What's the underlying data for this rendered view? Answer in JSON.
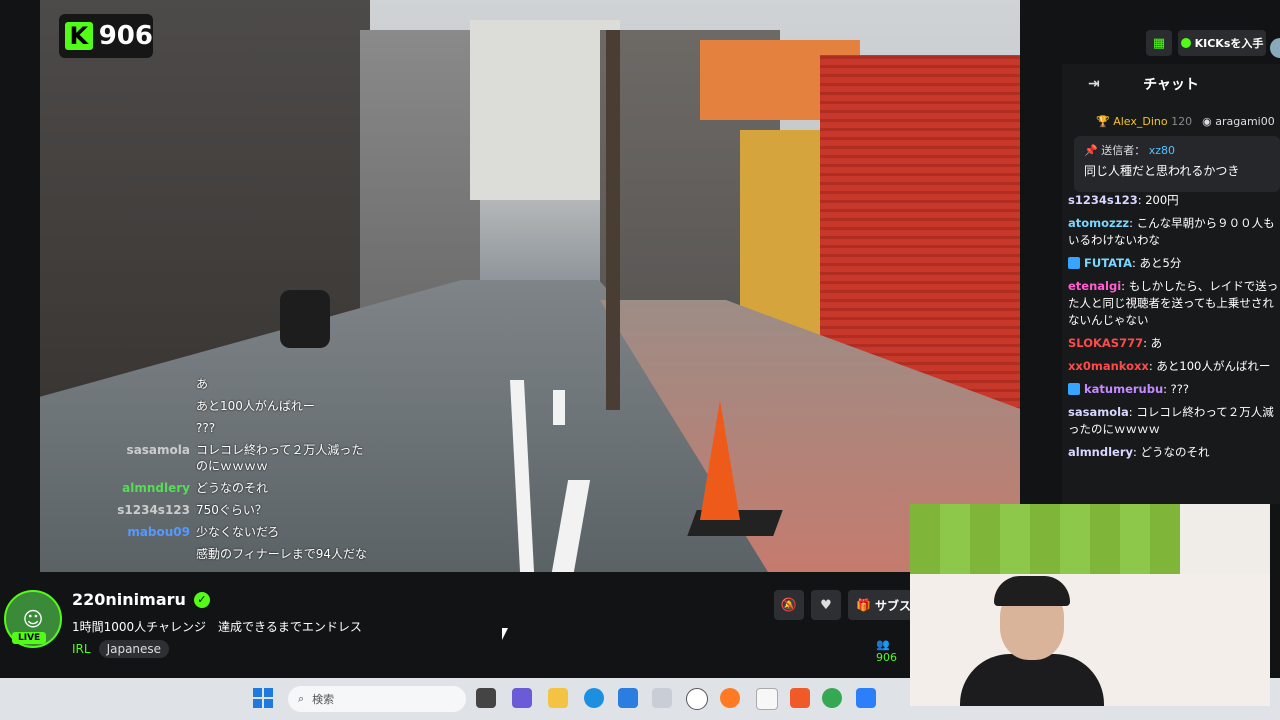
{
  "search_top": {
    "placeholder": "検索"
  },
  "viewer_badge": {
    "count": "906"
  },
  "overlay_chat": [
    {
      "user": "",
      "color": "#d33",
      "msg": "あ"
    },
    {
      "user": "",
      "color": "#d33",
      "msg": "あと100人がんばれー"
    },
    {
      "user": "",
      "color": "#a5f",
      "msg": "???"
    },
    {
      "user": "sasamola",
      "color": "#ccc",
      "msg": "コレコレ終わって２万人減ったのにｗｗｗｗ"
    },
    {
      "user": "almndlery",
      "color": "#5d5",
      "msg": "どうなのそれ"
    },
    {
      "user": "s1234s123",
      "color": "#ccc",
      "msg": "750ぐらい？"
    },
    {
      "user": "mabou09",
      "color": "#59f",
      "msg": "少なくないだろ"
    },
    {
      "user": "",
      "color": "#d33",
      "msg": "感動のフィナーレまで94人だな"
    }
  ],
  "top_right": {
    "kicks_label": "KICKsを入手"
  },
  "chat": {
    "title": "チャット",
    "leaders": [
      {
        "name": "Alex_Dino",
        "count": "120"
      },
      {
        "name": "aragami00",
        "count": ""
      }
    ],
    "pinned": {
      "label": "送信者：",
      "user": "xz80",
      "msg": "同じ人種だと思われるかつき"
    },
    "messages": [
      {
        "user": "s1234s123",
        "color": "#d7d7ff",
        "msg": ": 200円",
        "badge": false
      },
      {
        "user": "atomozzz",
        "color": "#7ad6ff",
        "msg": ": こんな早朝から９００人もいるわけないわな",
        "badge": false
      },
      {
        "user": "FUTATA",
        "color": "#7ad6ff",
        "msg": ": あと5分",
        "badge": true
      },
      {
        "user": "etenalgi",
        "color": "#ff5fd2",
        "msg": ": もしかしたら、レイドで送った人と同じ視聴者を送っても上乗せされないんじゃない",
        "badge": false
      },
      {
        "user": "SLOKAS777",
        "color": "#ff4a4a",
        "msg": ": あ",
        "badge": false
      },
      {
        "user": "xx0mankoxx",
        "color": "#ff4a4a",
        "msg": ": あと100人がんばれー",
        "badge": false
      },
      {
        "user": "katumerubu",
        "color": "#c58aff",
        "msg": ": ???",
        "badge": true
      },
      {
        "user": "sasamola",
        "color": "#d7d7ff",
        "msg": ": コレコレ終わって２万人減ったのにｗｗｗｗ",
        "badge": false
      },
      {
        "user": "almndlery",
        "color": "#d7d7ff",
        "msg": ": どうなのそれ",
        "badge": false
      }
    ]
  },
  "stream": {
    "channel": "220ninimaru",
    "title": "1時間1000人チャレンジ　達成できるまでエンドレス",
    "category": "IRL",
    "tag": "Japanese",
    "live_label": "LIVE",
    "sub_label": "サブス",
    "viewers": "906"
  },
  "taskbar": {
    "search_placeholder": "検索"
  }
}
